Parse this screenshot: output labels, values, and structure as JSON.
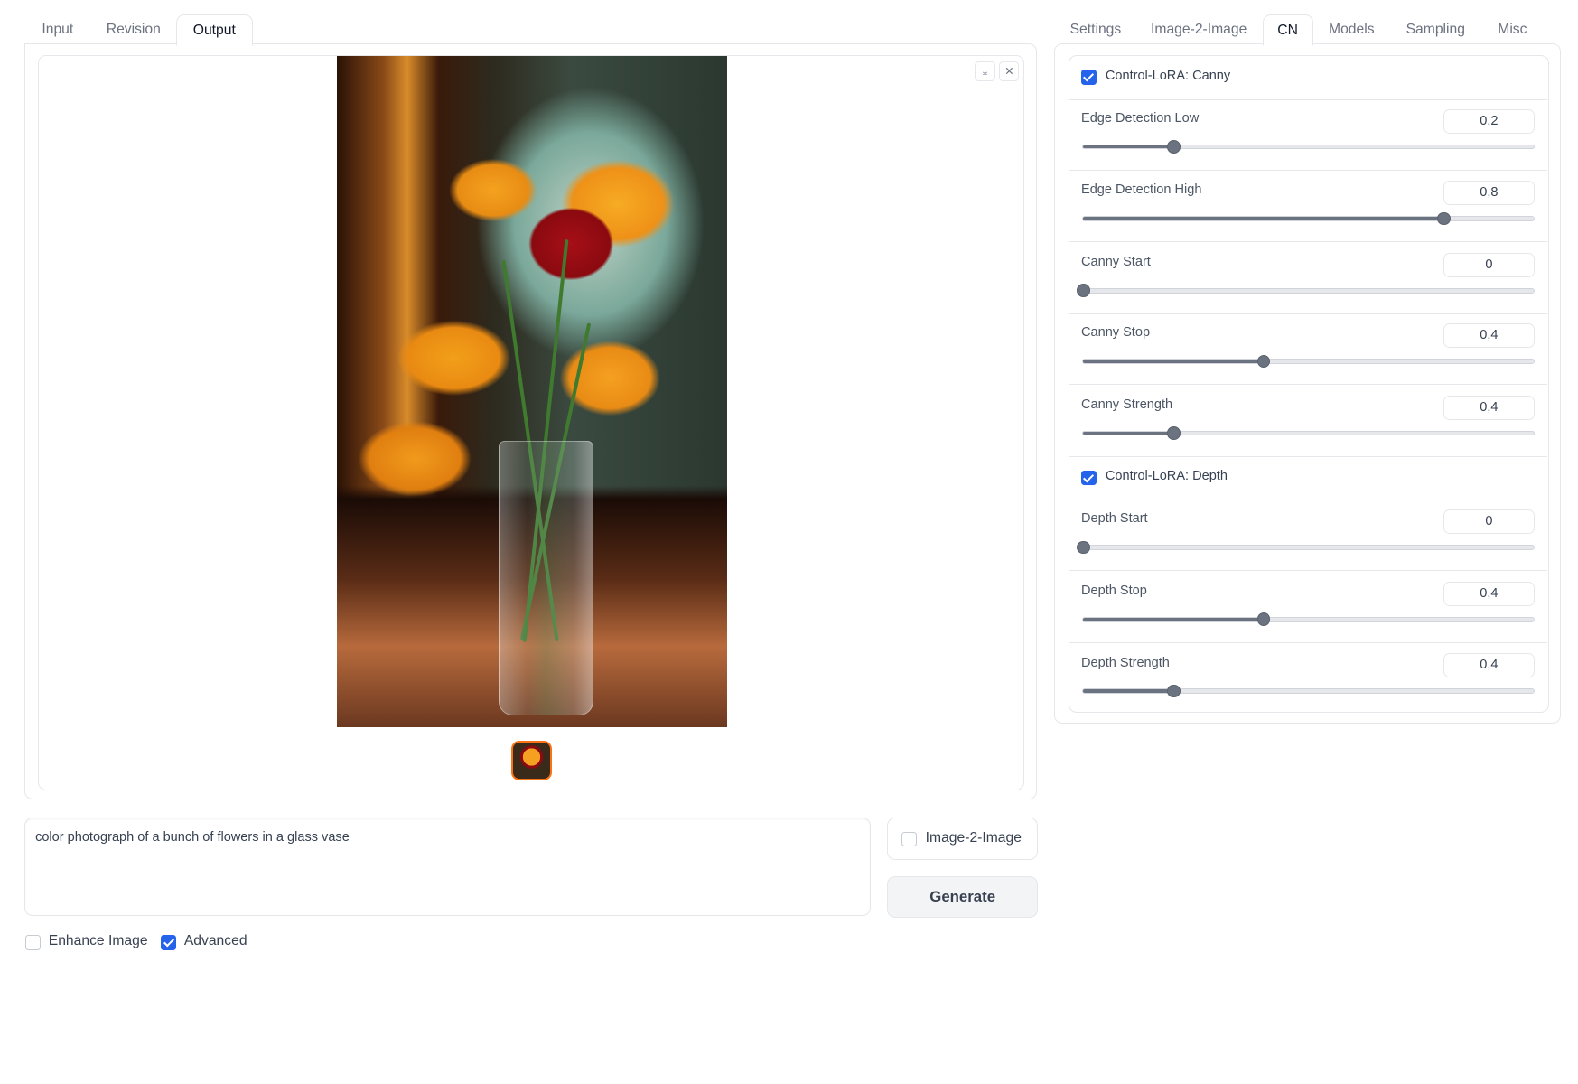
{
  "left_tabs": [
    {
      "label": "Input",
      "active": false
    },
    {
      "label": "Revision",
      "active": false
    },
    {
      "label": "Output",
      "active": true
    }
  ],
  "right_tabs": [
    {
      "label": "Settings",
      "active": false
    },
    {
      "label": "Image-2-Image",
      "active": false
    },
    {
      "label": "CN",
      "active": true
    },
    {
      "label": "Models",
      "active": false
    },
    {
      "label": "Sampling",
      "active": false
    },
    {
      "label": "Misc",
      "active": false
    }
  ],
  "gallery": {
    "download_icon": "download-icon",
    "close_icon": "close-icon",
    "download_glyph": "⤓",
    "close_glyph": "✕"
  },
  "prompt": {
    "value": "color photograph of a bunch of flowers in a glass vase"
  },
  "image2image": {
    "label": "Image-2-Image",
    "checked": false
  },
  "generate_label": "Generate",
  "enhance": {
    "label": "Enhance Image",
    "checked": false
  },
  "advanced": {
    "label": "Advanced",
    "checked": true
  },
  "cn": {
    "canny": {
      "label": "Control-LoRA: Canny",
      "checked": true
    },
    "canny_sliders": [
      {
        "label": "Edge Detection Low",
        "value": "0,2",
        "fraction": 0.2
      },
      {
        "label": "Edge Detection High",
        "value": "0,8",
        "fraction": 0.8
      },
      {
        "label": "Canny Start",
        "value": "0",
        "fraction": 0.0
      },
      {
        "label": "Canny Stop",
        "value": "0,4",
        "fraction": 0.4
      },
      {
        "label": "Canny Strength",
        "value": "0,4",
        "fraction": 0.2
      }
    ],
    "depth": {
      "label": "Control-LoRA: Depth",
      "checked": true
    },
    "depth_sliders": [
      {
        "label": "Depth Start",
        "value": "0",
        "fraction": 0.0
      },
      {
        "label": "Depth Stop",
        "value": "0,4",
        "fraction": 0.4
      },
      {
        "label": "Depth Strength",
        "value": "0,4",
        "fraction": 0.2
      }
    ]
  },
  "colors": {
    "accent": "#2563eb",
    "thumb_border": "#f97316",
    "slider": "#6b7280"
  }
}
